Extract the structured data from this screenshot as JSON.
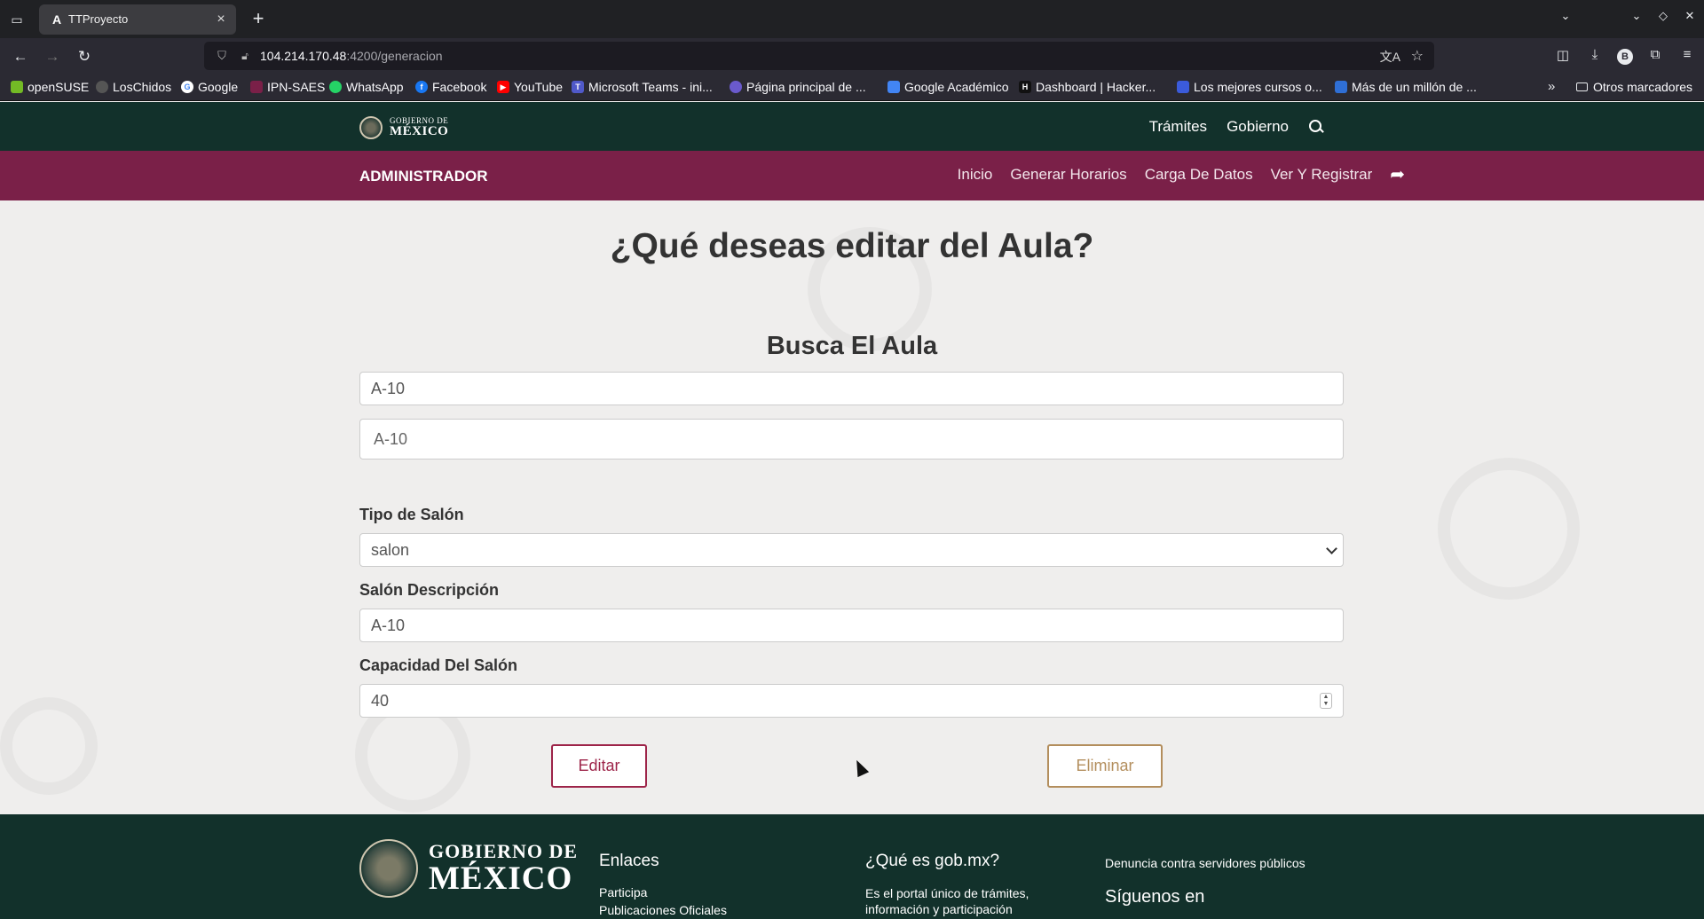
{
  "browser": {
    "tab_title": "TTProyecto",
    "tab_favicon": "A",
    "url_host": "104.214.170.48",
    "url_path": ":4200/generacion",
    "bookmarks": [
      {
        "label": "openSUSE",
        "icon": "opensuse-icon",
        "color": "#73ba25"
      },
      {
        "label": "LosChidos",
        "icon": "github-icon",
        "color": "#444"
      },
      {
        "label": "Google",
        "icon": "google-icon",
        "color": "#4285f4"
      },
      {
        "label": "IPN-SAES",
        "icon": "ipn-icon",
        "color": "#7a2048"
      },
      {
        "label": "WhatsApp",
        "icon": "whatsapp-icon",
        "color": "#25d366"
      },
      {
        "label": "Facebook",
        "icon": "facebook-icon",
        "color": "#1877f2"
      },
      {
        "label": "YouTube",
        "icon": "youtube-icon",
        "color": "#ff0000"
      },
      {
        "label": "Microsoft Teams - ini...",
        "icon": "teams-icon",
        "color": "#5059c9"
      },
      {
        "label": "Página principal de ...",
        "icon": "page-icon",
        "color": "#6a5acd"
      },
      {
        "label": "Google Académico",
        "icon": "scholar-icon",
        "color": "#4285f4"
      },
      {
        "label": "Dashboard | Hacker...",
        "icon": "hackerrank-icon",
        "color": "#111"
      },
      {
        "label": "Los mejores cursos o...",
        "icon": "courses-icon",
        "color": "#3b5bdb"
      },
      {
        "label": "Más de un millón de ...",
        "icon": "link-icon",
        "color": "#2f6fd6"
      }
    ],
    "other_bookmarks": "Otros marcadores"
  },
  "gob_header": {
    "logo_line1": "GOBIERNO DE",
    "logo_line2": "MÉXICO",
    "nav": [
      "Trámites",
      "Gobierno"
    ]
  },
  "admin_bar": {
    "title": "ADMINISTRADOR",
    "nav": [
      "Inicio",
      "Generar Horarios",
      "Carga De Datos",
      "Ver Y Registrar"
    ]
  },
  "main": {
    "title": "¿Qué deseas editar del Aula?",
    "section_title": "Busca El Aula",
    "search_value": "A-10",
    "search_result": "A-10",
    "tipo_label": "Tipo de Salón",
    "tipo_value": "salon",
    "desc_label": "Salón Descripción",
    "desc_value": "A-10",
    "cap_label": "Capacidad Del Salón",
    "cap_value": "40",
    "edit_button": "Editar",
    "delete_button": "Eliminar"
  },
  "footer": {
    "logo_line1": "GOBIERNO DE",
    "logo_line2": "MÉXICO",
    "enlaces_title": "Enlaces",
    "enlaces_items": [
      "Participa",
      "Publicaciones Oficiales"
    ],
    "que_es_title": "¿Qué es gob.mx?",
    "que_es_text": "Es el portal único de trámites, información y participación",
    "denuncia": "Denuncia contra servidores públicos",
    "siguenos": "Síguenos en"
  },
  "colors": {
    "gob_green": "#12312b",
    "admin_maroon": "#7a2048",
    "edit_red": "#9d2449",
    "delete_gold": "#b38e5d"
  }
}
